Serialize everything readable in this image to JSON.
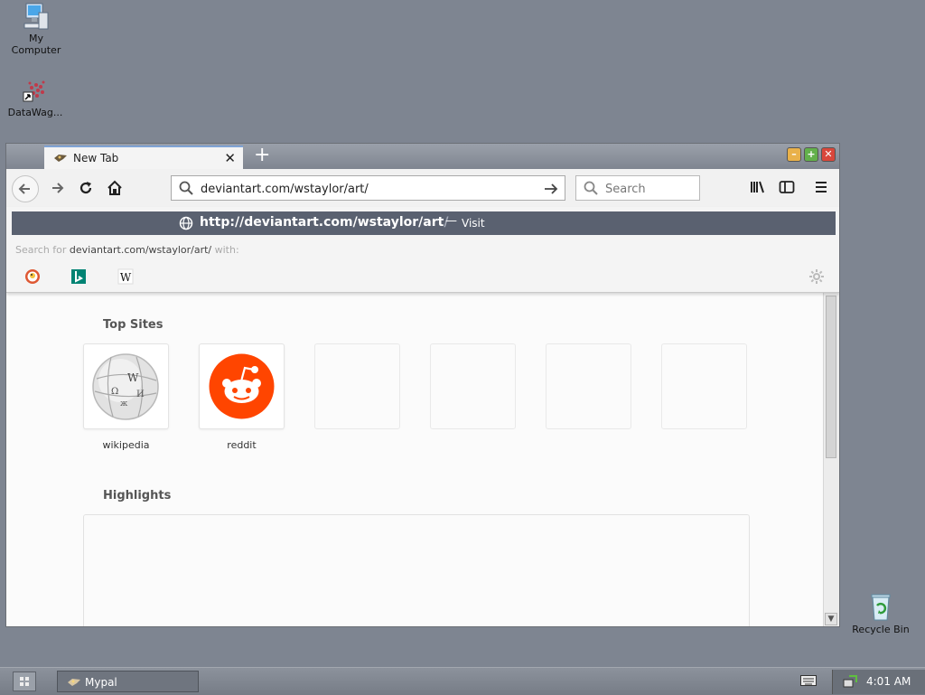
{
  "desktop": {
    "icons": [
      {
        "label_line1": "My",
        "label_line2": "Computer"
      },
      {
        "label_line1": "DataWag...",
        "label_line2": ""
      },
      {
        "label_line1": "Recycle Bin",
        "label_line2": ""
      }
    ]
  },
  "browser": {
    "tab": {
      "title": "New Tab",
      "close": "✕"
    },
    "new_tab": "+",
    "window_buttons": {
      "minimize": "–",
      "maximize": "+",
      "close": "✕"
    },
    "url_value": "deviantart.com/wstaylor/art/",
    "search_placeholder": "Search",
    "dropdown": {
      "suggestion_url_bold": "http://deviantart.com/wstaylor/art",
      "suggestion_url_faded": "/",
      "separator": "—",
      "visit_label": "Visit",
      "search_for_prefix": "Search for",
      "search_for_term": "deviantart.com/wstaylor/art/",
      "search_for_suffix": "with:",
      "engines": [
        "duckduckgo-icon",
        "bing-icon",
        "wikipedia-icon"
      ]
    }
  },
  "newtab": {
    "top_sites_title": "Top Sites",
    "top_sites": [
      {
        "label": "wikipedia"
      },
      {
        "label": "reddit"
      }
    ],
    "highlights_title": "Highlights"
  },
  "taskbar": {
    "task_label": "Mypal",
    "clock": "4:01 AM"
  },
  "colors": {
    "desktop": "#7e8591",
    "suggestion_bg": "#5a6170",
    "reddit": "#ff4500"
  }
}
